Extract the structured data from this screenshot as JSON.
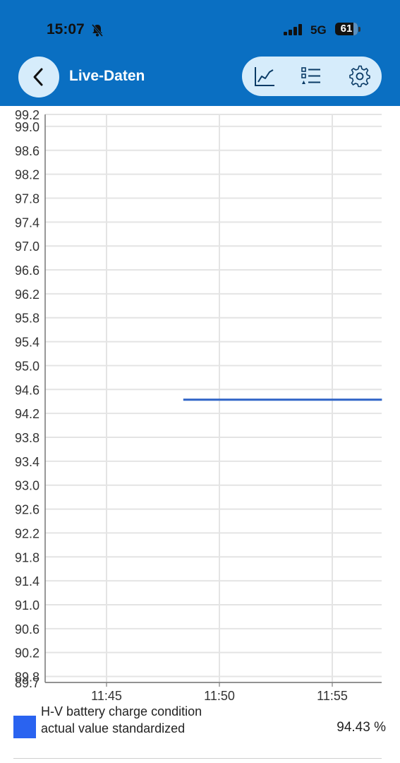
{
  "status_bar": {
    "time": "15:07",
    "network": "5G",
    "battery": "61"
  },
  "header": {
    "title": "Live-Daten",
    "actions": [
      "chart-icon",
      "list-icon",
      "gear-icon"
    ]
  },
  "chart_data": {
    "type": "line",
    "y_ticks": [
      "99.2",
      "99.0",
      "98.6",
      "98.2",
      "97.8",
      "97.4",
      "97.0",
      "96.6",
      "96.2",
      "95.8",
      "95.4",
      "95.0",
      "94.6",
      "94.2",
      "93.8",
      "93.4",
      "93.0",
      "92.6",
      "92.2",
      "91.8",
      "91.4",
      "91.0",
      "90.6",
      "90.2",
      "89.8",
      "89.7"
    ],
    "ylim": [
      89.7,
      99.2
    ],
    "x_ticks": [
      "11:45",
      "11:50",
      "11:55"
    ],
    "series": [
      {
        "name": "H-V battery charge condition actual value standardized",
        "color": "#2f64c7",
        "x": [
          "11:48.4",
          "11:57.2"
        ],
        "y": [
          94.43,
          94.43
        ]
      }
    ],
    "grid": true
  },
  "legend": {
    "label": "H-V battery charge condition actual value standardized",
    "value": "94.43 %",
    "color": "#2a63f0"
  }
}
